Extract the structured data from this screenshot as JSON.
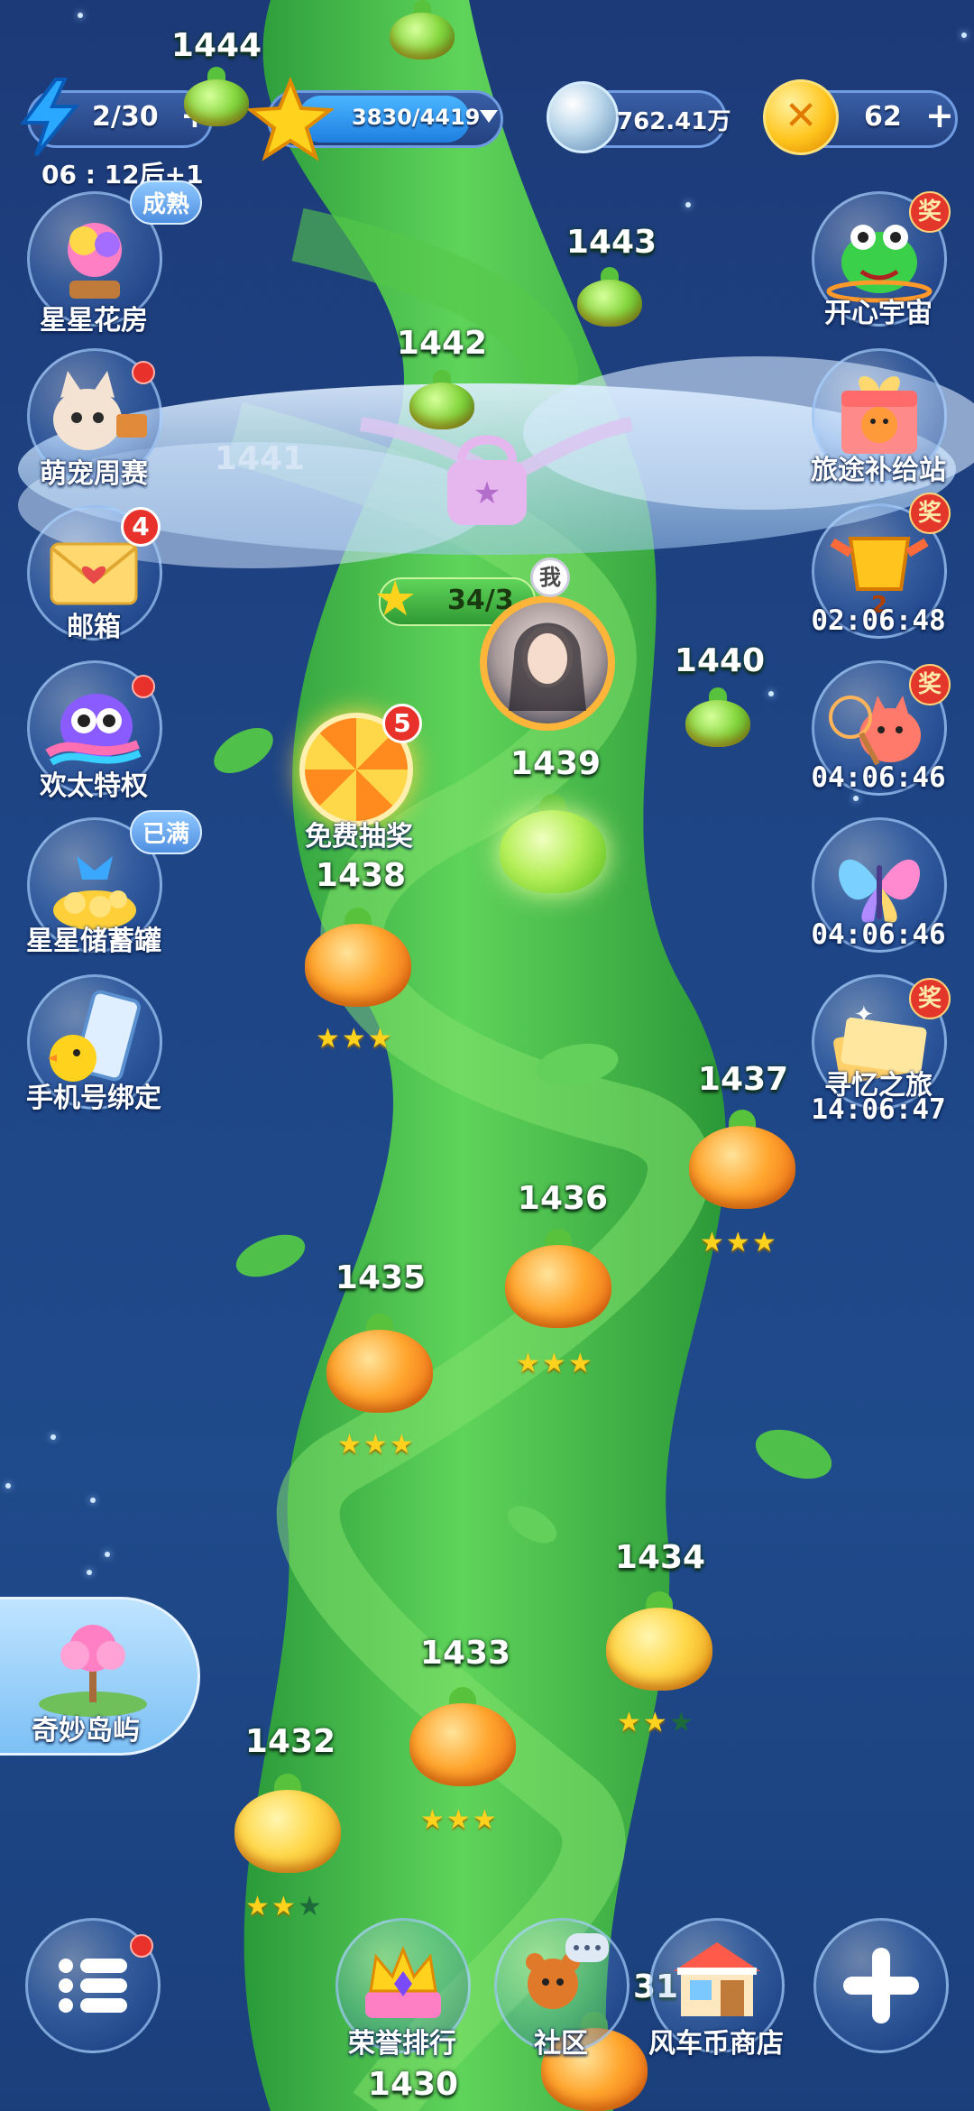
{
  "topbar": {
    "energy": "2/30",
    "energy_timer": "06 : 12后+1",
    "stars_progress": "3830/4419",
    "stars_fill": 0.867,
    "pearls": "762.41万",
    "coins": "62",
    "plus": "+"
  },
  "left_menu": [
    {
      "label": "星星花房",
      "icon": "flower-house-icon",
      "tag": "成熟"
    },
    {
      "label": "萌宠周赛",
      "icon": "pet-cat-icon"
    },
    {
      "label": "邮箱",
      "icon": "mail-icon",
      "badge": "4"
    },
    {
      "label": "欢太特权",
      "icon": "owl-privilege-icon"
    },
    {
      "label": "星星储蓄罐",
      "icon": "star-piggy-bank-icon",
      "tag": "已满"
    },
    {
      "label": "手机号绑定",
      "icon": "phone-bind-icon"
    }
  ],
  "right_menu": [
    {
      "label": "开心宇宙",
      "icon": "frog-universe-icon",
      "reward": "奖"
    },
    {
      "label": "旅途补给站",
      "icon": "gift-box-icon"
    },
    {
      "timer": "02:06:48",
      "icon": "trophy-icon",
      "reward": "奖",
      "rank": "2"
    },
    {
      "timer": "04:06:46",
      "icon": "fox-net-icon",
      "reward": "奖"
    },
    {
      "timer": "04:06:46",
      "icon": "butterfly-icon"
    },
    {
      "label": "寻忆之旅",
      "timer": "14:06:47",
      "icon": "memory-book-icon",
      "reward": "奖"
    }
  ],
  "lottery": {
    "label": "免费抽奖",
    "badge": "5"
  },
  "player": {
    "tag": "我",
    "stars": "34/3"
  },
  "island": {
    "label": "奇妙岛屿"
  },
  "levels": [
    {
      "num": "1444",
      "stars": null
    },
    {
      "num": "1443",
      "stars": null
    },
    {
      "num": "1442",
      "stars": null
    },
    {
      "num": "1441",
      "stars": null,
      "locked": true
    },
    {
      "num": "1440",
      "stars": null
    },
    {
      "num": "1439",
      "stars": null,
      "current": true
    },
    {
      "num": "1438",
      "stars": 3
    },
    {
      "num": "1437",
      "stars": 3
    },
    {
      "num": "1436",
      "stars": 3
    },
    {
      "num": "1435",
      "stars": 3
    },
    {
      "num": "1434",
      "stars": 2
    },
    {
      "num": "1433",
      "stars": 3
    },
    {
      "num": "1432",
      "stars": 2
    },
    {
      "num": "1431",
      "stars": null
    },
    {
      "num": "1430",
      "stars": null
    }
  ],
  "bottom": [
    {
      "label": "",
      "icon": "menu-list-icon"
    },
    {
      "label": "荣誉排行",
      "icon": "crown-icon"
    },
    {
      "label": "社区",
      "icon": "community-bear-icon"
    },
    {
      "label": "风车币商店",
      "icon": "shop-icon"
    },
    {
      "label": "",
      "icon": "plus-icon"
    }
  ],
  "colors": {
    "star": "#ffd21e",
    "badge": "#e8312a",
    "vine": "#3fbf45",
    "bg": "#1e4585"
  }
}
